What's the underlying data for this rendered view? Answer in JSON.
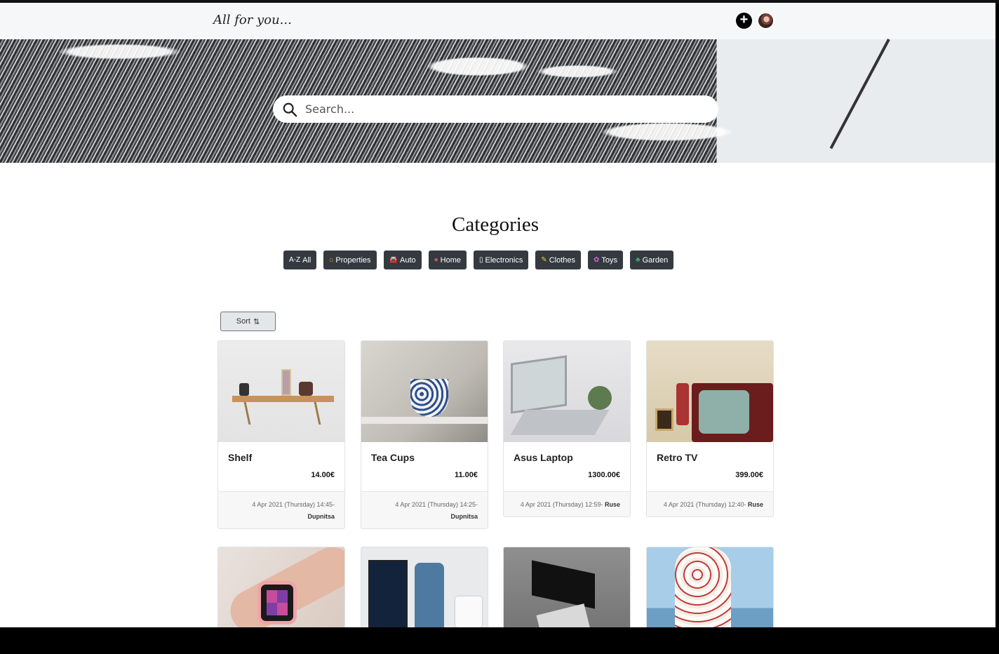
{
  "brand": "All for you...",
  "header": {
    "add_icon": "plus-circle-icon",
    "avatar_icon": "user-avatar"
  },
  "search": {
    "placeholder": "Search..."
  },
  "categories_title": "Categories",
  "categories": [
    {
      "label": "All",
      "icon": "az-icon",
      "glyph": "A-Z",
      "color": "#ffffff"
    },
    {
      "label": "Properties",
      "icon": "house-icon",
      "glyph": "⌂",
      "color": "#f0a820"
    },
    {
      "label": "Auto",
      "icon": "car-icon",
      "glyph": "🚘",
      "color": "#3a7bd5"
    },
    {
      "label": "Home",
      "icon": "home-icon",
      "glyph": "●",
      "color": "#e0554f"
    },
    {
      "label": "Electronics",
      "icon": "phone-icon",
      "glyph": "▯",
      "color": "#ffffff"
    },
    {
      "label": "Clothes",
      "icon": "clothes-icon",
      "glyph": "✎",
      "color": "#f2d22e"
    },
    {
      "label": "Toys",
      "icon": "toy-icon",
      "glyph": "✿",
      "color": "#c86ad8"
    },
    {
      "label": "Garden",
      "icon": "tree-icon",
      "glyph": "♣",
      "color": "#42b06a"
    }
  ],
  "sort": {
    "label": "Sort",
    "icon": "sort-icon",
    "glyph": "⇅"
  },
  "products": [
    {
      "title": "Shelf",
      "price": "14.00€",
      "date": "4 Apr 2021 (Thursday) 14:45-",
      "city": "Dupnitsa"
    },
    {
      "title": "Tea Cups",
      "price": "11.00€",
      "date": "4 Apr 2021 (Thursday) 14:25-",
      "city": "Dupnitsa"
    },
    {
      "title": "Asus Laptop",
      "price": "1300.00€",
      "date": "4 Apr 2021 (Thursday) 12:59-",
      "city": "Ruse"
    },
    {
      "title": "Retro TV",
      "price": "399.00€",
      "date": "4 Apr 2021 (Thursday) 12:40-",
      "city": "Ruse"
    }
  ]
}
